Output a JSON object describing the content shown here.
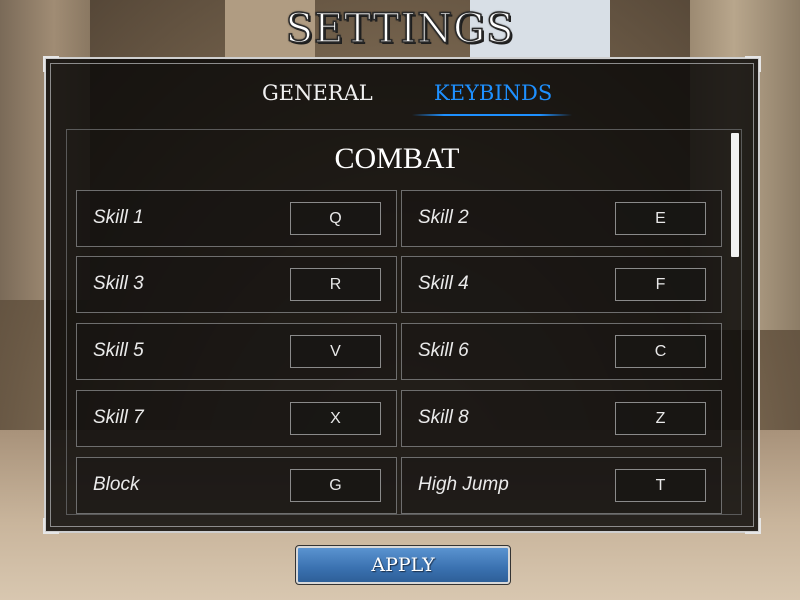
{
  "title": "SETTINGS",
  "tabs": [
    {
      "label": "GENERAL",
      "active": false
    },
    {
      "label": "KEYBINDS",
      "active": true
    }
  ],
  "section": {
    "title": "COMBAT",
    "keybinds": [
      {
        "label": "Skill 1",
        "key": "Q"
      },
      {
        "label": "Skill 2",
        "key": "E"
      },
      {
        "label": "Skill 3",
        "key": "R"
      },
      {
        "label": "Skill 4",
        "key": "F"
      },
      {
        "label": "Skill 5",
        "key": "V"
      },
      {
        "label": "Skill 6",
        "key": "C"
      },
      {
        "label": "Skill 7",
        "key": "X"
      },
      {
        "label": "Skill 8",
        "key": "Z"
      },
      {
        "label": "Block",
        "key": "G"
      },
      {
        "label": "High Jump",
        "key": "T"
      }
    ]
  },
  "apply_label": "APPLY",
  "colors": {
    "active_tab": "#1e90ff",
    "apply_button": "#3a71b0",
    "panel_bg": "#0c0a09"
  }
}
